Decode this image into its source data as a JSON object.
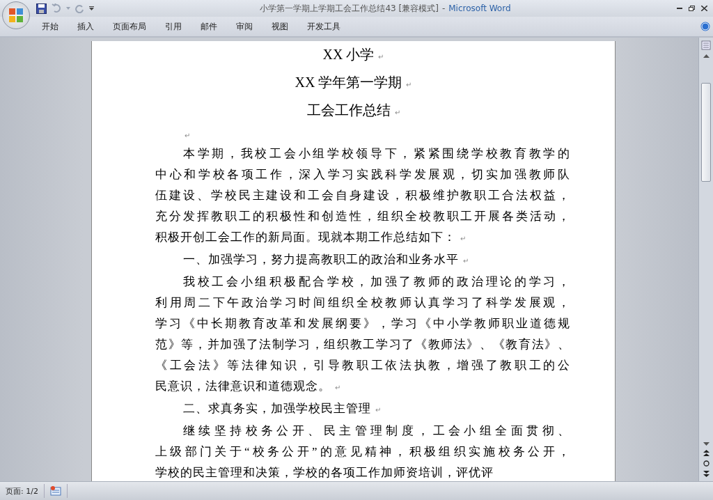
{
  "window": {
    "title": "小学第一学期上学期工会工作总结43 [兼容模式]",
    "separator": "-",
    "app_name": "Microsoft Word"
  },
  "ribbon_tabs": [
    {
      "label": "开始"
    },
    {
      "label": "插入"
    },
    {
      "label": "页面布局"
    },
    {
      "label": "引用"
    },
    {
      "label": "邮件"
    },
    {
      "label": "审阅"
    },
    {
      "label": "视图"
    },
    {
      "label": "开发工具"
    }
  ],
  "document": {
    "titles": [
      {
        "text": "XX 小学",
        "mark": "↵"
      },
      {
        "text": "XX 学年第一学期",
        "mark": "↵"
      },
      {
        "text": "工会工作总结",
        "mark": "↵"
      }
    ],
    "paragraphs": [
      {
        "kind": "blank",
        "mark": "↵"
      },
      {
        "kind": "body",
        "lines": [
          "本学期，我校工会小组学校领导下，紧紧围绕学校教育教学的",
          "中心和学校各项工作，深入学习实践科学发展观，切实加强教师队",
          "伍建设、学校民主建设和工会自身建设，积极维护教职工合法权益，",
          "充分发挥教职工的积极性和创造性，组织全校教职工开展各类活动，",
          "积极开创工会工作的新局面。现就本期工作总结如下："
        ],
        "mark": "↵"
      },
      {
        "kind": "body",
        "lines": [
          "一、加强学习，努力提高教职工的政治和业务水平"
        ],
        "mark": "↵"
      },
      {
        "kind": "body",
        "lines": [
          "我校工会小组积极配合学校，加强了教师的政治理论的学习，",
          "利用周二下午政治学习时间组织全校教师认真学习了科学发展观，",
          "学习《中长期教育改革和发展纲要》，学习《中小学教师职业道德规",
          "范》等，并加强了法制学习，组织教工学习了《教师法》、《教育法》、",
          "《工会法》等法律知识，引导教职工依法执教，增强了教职工的公",
          "民意识，法律意识和道德观念。"
        ],
        "mark": "↵"
      },
      {
        "kind": "body",
        "lines": [
          "二、求真务实，加强学校民主管理"
        ],
        "mark": "↵"
      },
      {
        "kind": "body",
        "lines": [
          "继续坚持校务公开、民主管理制度，工会小组全面贯彻、",
          "上级部门关于“校务公开”的意见精神，积极组织实施校务公开，",
          "学校的民主管理和决策，学校的各项工作加师资培训，评优评"
        ]
      }
    ]
  },
  "status_bar": {
    "page": "页面: 1/2"
  }
}
